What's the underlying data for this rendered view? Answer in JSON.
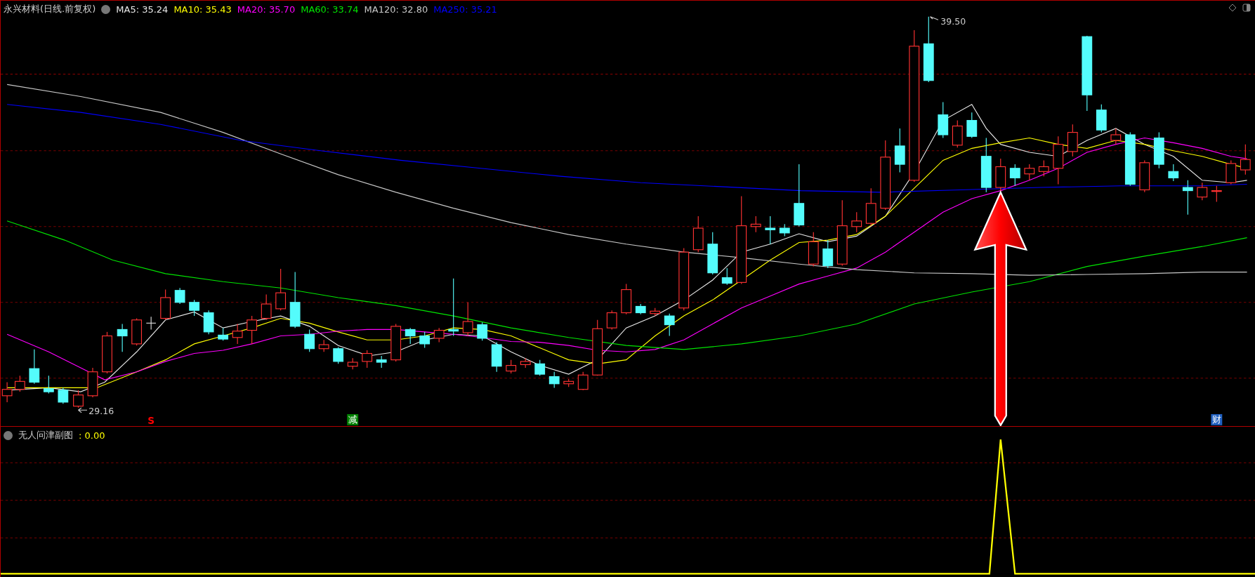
{
  "main_panel": {
    "title": "永兴材料(日线.前复权)",
    "indicators": [
      {
        "label": "MA5: 35.24",
        "color": "#e8e8e8"
      },
      {
        "label": "MA10: 35.43",
        "color": "#ffff00"
      },
      {
        "label": "MA20: 35.70",
        "color": "#ff00ff"
      },
      {
        "label": "MA60: 33.74",
        "color": "#00e600"
      },
      {
        "label": "MA120: 32.80",
        "color": "#c8c8c8"
      },
      {
        "label": "MA250: 35.21",
        "color": "#0000ff"
      }
    ],
    "high_label": "39.50",
    "low_label": "29.16",
    "markers": [
      {
        "text": "S",
        "color": "#ff0000"
      },
      {
        "text": "减",
        "color": "#008000"
      },
      {
        "text": "财",
        "color": "#1f5fbf"
      }
    ]
  },
  "sub_panel": {
    "title": "无人问津副图",
    "value": ": 0.00"
  }
}
